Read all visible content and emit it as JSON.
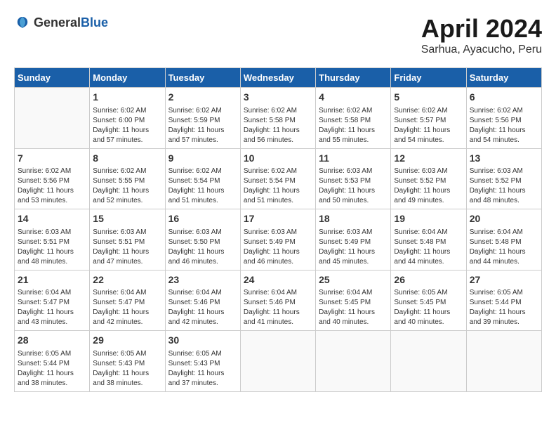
{
  "header": {
    "logo_general": "General",
    "logo_blue": "Blue",
    "month_title": "April 2024",
    "subtitle": "Sarhua, Ayacucho, Peru"
  },
  "weekdays": [
    "Sunday",
    "Monday",
    "Tuesday",
    "Wednesday",
    "Thursday",
    "Friday",
    "Saturday"
  ],
  "weeks": [
    [
      {
        "day": "",
        "info": ""
      },
      {
        "day": "1",
        "info": "Sunrise: 6:02 AM\nSunset: 6:00 PM\nDaylight: 11 hours\nand 57 minutes."
      },
      {
        "day": "2",
        "info": "Sunrise: 6:02 AM\nSunset: 5:59 PM\nDaylight: 11 hours\nand 57 minutes."
      },
      {
        "day": "3",
        "info": "Sunrise: 6:02 AM\nSunset: 5:58 PM\nDaylight: 11 hours\nand 56 minutes."
      },
      {
        "day": "4",
        "info": "Sunrise: 6:02 AM\nSunset: 5:58 PM\nDaylight: 11 hours\nand 55 minutes."
      },
      {
        "day": "5",
        "info": "Sunrise: 6:02 AM\nSunset: 5:57 PM\nDaylight: 11 hours\nand 54 minutes."
      },
      {
        "day": "6",
        "info": "Sunrise: 6:02 AM\nSunset: 5:56 PM\nDaylight: 11 hours\nand 54 minutes."
      }
    ],
    [
      {
        "day": "7",
        "info": "Sunrise: 6:02 AM\nSunset: 5:56 PM\nDaylight: 11 hours\nand 53 minutes."
      },
      {
        "day": "8",
        "info": "Sunrise: 6:02 AM\nSunset: 5:55 PM\nDaylight: 11 hours\nand 52 minutes."
      },
      {
        "day": "9",
        "info": "Sunrise: 6:02 AM\nSunset: 5:54 PM\nDaylight: 11 hours\nand 51 minutes."
      },
      {
        "day": "10",
        "info": "Sunrise: 6:02 AM\nSunset: 5:54 PM\nDaylight: 11 hours\nand 51 minutes."
      },
      {
        "day": "11",
        "info": "Sunrise: 6:03 AM\nSunset: 5:53 PM\nDaylight: 11 hours\nand 50 minutes."
      },
      {
        "day": "12",
        "info": "Sunrise: 6:03 AM\nSunset: 5:52 PM\nDaylight: 11 hours\nand 49 minutes."
      },
      {
        "day": "13",
        "info": "Sunrise: 6:03 AM\nSunset: 5:52 PM\nDaylight: 11 hours\nand 48 minutes."
      }
    ],
    [
      {
        "day": "14",
        "info": "Sunrise: 6:03 AM\nSunset: 5:51 PM\nDaylight: 11 hours\nand 48 minutes."
      },
      {
        "day": "15",
        "info": "Sunrise: 6:03 AM\nSunset: 5:51 PM\nDaylight: 11 hours\nand 47 minutes."
      },
      {
        "day": "16",
        "info": "Sunrise: 6:03 AM\nSunset: 5:50 PM\nDaylight: 11 hours\nand 46 minutes."
      },
      {
        "day": "17",
        "info": "Sunrise: 6:03 AM\nSunset: 5:49 PM\nDaylight: 11 hours\nand 46 minutes."
      },
      {
        "day": "18",
        "info": "Sunrise: 6:03 AM\nSunset: 5:49 PM\nDaylight: 11 hours\nand 45 minutes."
      },
      {
        "day": "19",
        "info": "Sunrise: 6:04 AM\nSunset: 5:48 PM\nDaylight: 11 hours\nand 44 minutes."
      },
      {
        "day": "20",
        "info": "Sunrise: 6:04 AM\nSunset: 5:48 PM\nDaylight: 11 hours\nand 44 minutes."
      }
    ],
    [
      {
        "day": "21",
        "info": "Sunrise: 6:04 AM\nSunset: 5:47 PM\nDaylight: 11 hours\nand 43 minutes."
      },
      {
        "day": "22",
        "info": "Sunrise: 6:04 AM\nSunset: 5:47 PM\nDaylight: 11 hours\nand 42 minutes."
      },
      {
        "day": "23",
        "info": "Sunrise: 6:04 AM\nSunset: 5:46 PM\nDaylight: 11 hours\nand 42 minutes."
      },
      {
        "day": "24",
        "info": "Sunrise: 6:04 AM\nSunset: 5:46 PM\nDaylight: 11 hours\nand 41 minutes."
      },
      {
        "day": "25",
        "info": "Sunrise: 6:04 AM\nSunset: 5:45 PM\nDaylight: 11 hours\nand 40 minutes."
      },
      {
        "day": "26",
        "info": "Sunrise: 6:05 AM\nSunset: 5:45 PM\nDaylight: 11 hours\nand 40 minutes."
      },
      {
        "day": "27",
        "info": "Sunrise: 6:05 AM\nSunset: 5:44 PM\nDaylight: 11 hours\nand 39 minutes."
      }
    ],
    [
      {
        "day": "28",
        "info": "Sunrise: 6:05 AM\nSunset: 5:44 PM\nDaylight: 11 hours\nand 38 minutes."
      },
      {
        "day": "29",
        "info": "Sunrise: 6:05 AM\nSunset: 5:43 PM\nDaylight: 11 hours\nand 38 minutes."
      },
      {
        "day": "30",
        "info": "Sunrise: 6:05 AM\nSunset: 5:43 PM\nDaylight: 11 hours\nand 37 minutes."
      },
      {
        "day": "",
        "info": ""
      },
      {
        "day": "",
        "info": ""
      },
      {
        "day": "",
        "info": ""
      },
      {
        "day": "",
        "info": ""
      }
    ]
  ]
}
